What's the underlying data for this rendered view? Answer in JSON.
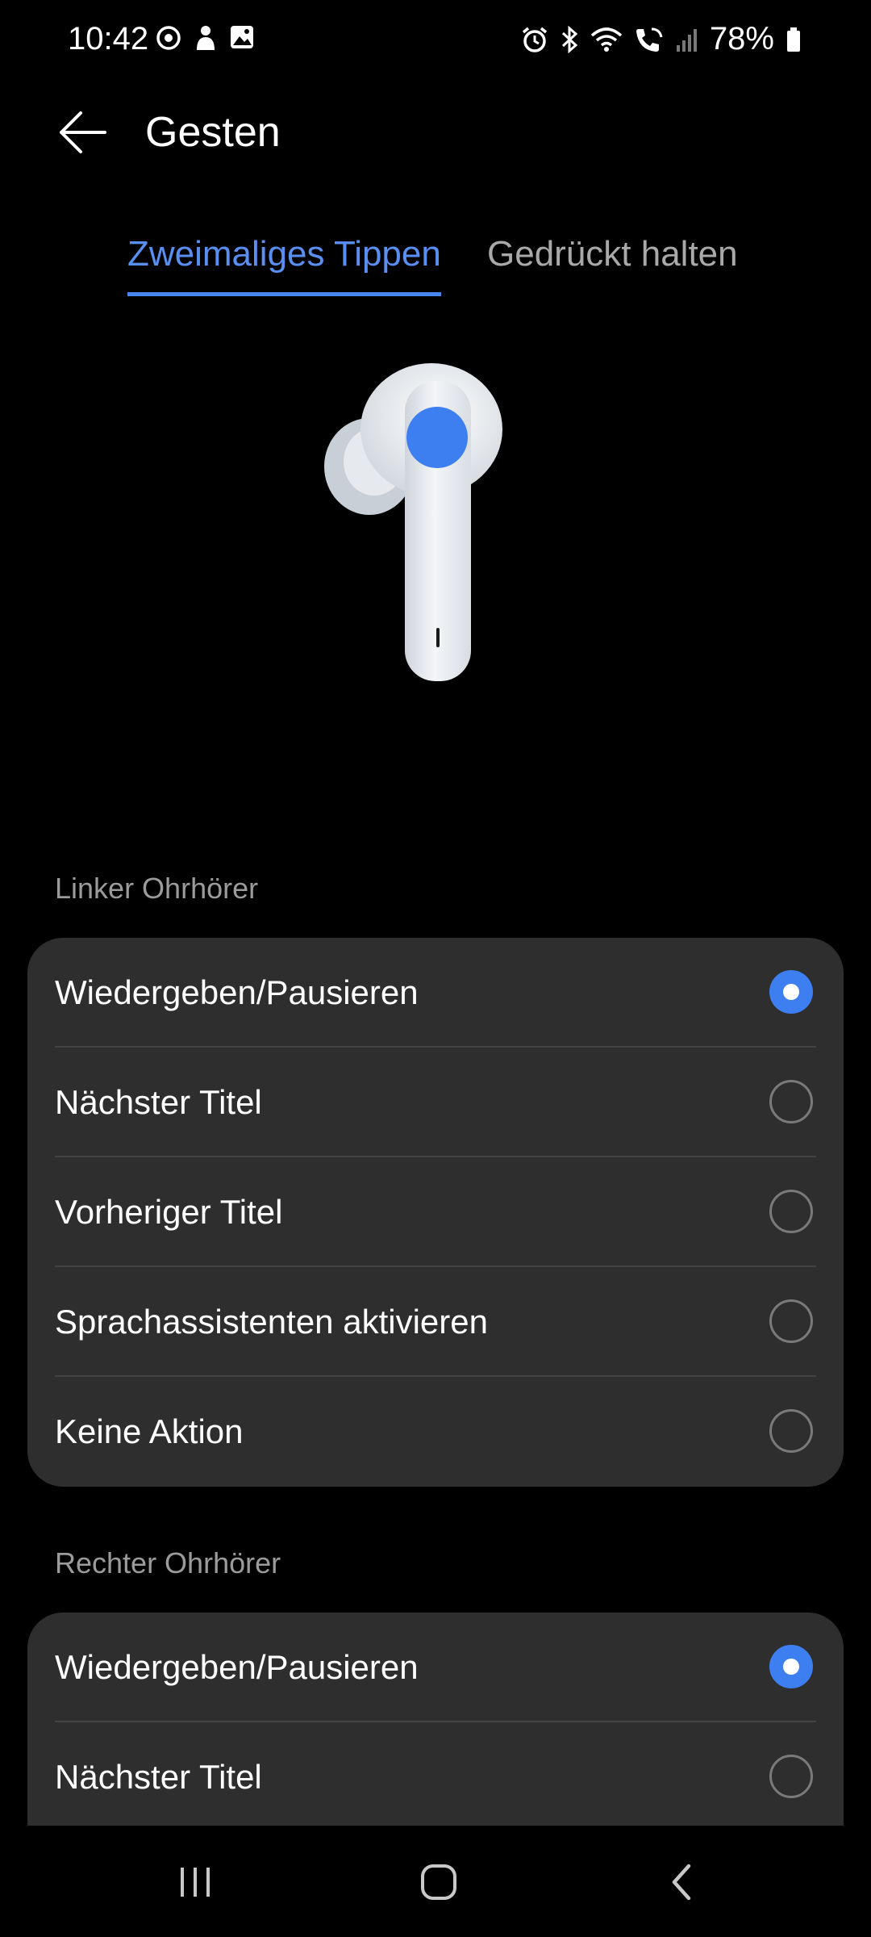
{
  "status_bar": {
    "time": "10:42",
    "battery": "78%",
    "left_icons": [
      "sync-icon",
      "bixby-icon",
      "gallery-icon"
    ],
    "right_icons": [
      "alarm-icon",
      "bluetooth-icon",
      "wifi-icon",
      "wifi-calling-icon",
      "signal-icon",
      "battery-icon"
    ]
  },
  "app_bar": {
    "title": "Gesten",
    "back_icon": "arrow-left-icon"
  },
  "tabs": [
    {
      "label": "Zweimaliges Tippen",
      "active": true
    },
    {
      "label": "Gedrückt halten",
      "active": false
    }
  ],
  "earbud": {
    "icon": "earbud-illustration",
    "highlight_color": "#3d7ff0"
  },
  "left_earbud": {
    "label": "Linker Ohrhörer",
    "options": [
      {
        "label": "Wiedergeben/Pausieren",
        "selected": true
      },
      {
        "label": "Nächster Titel",
        "selected": false
      },
      {
        "label": "Vorheriger Titel",
        "selected": false
      },
      {
        "label": "Sprachassistenten aktivieren",
        "selected": false
      },
      {
        "label": "Keine Aktion",
        "selected": false
      }
    ]
  },
  "right_earbud": {
    "label": "Rechter Ohrhörer",
    "options": [
      {
        "label": "Wiedergeben/Pausieren",
        "selected": true
      },
      {
        "label": "Nächster Titel",
        "selected": false
      }
    ]
  },
  "nav_bar": {
    "icons": [
      "recent-apps-icon",
      "home-icon",
      "back-icon"
    ]
  },
  "colors": {
    "accent": "#3d7ff0",
    "tab_active": "#5a8ff2",
    "card_background": "#2e2e2e",
    "background": "#000000"
  }
}
